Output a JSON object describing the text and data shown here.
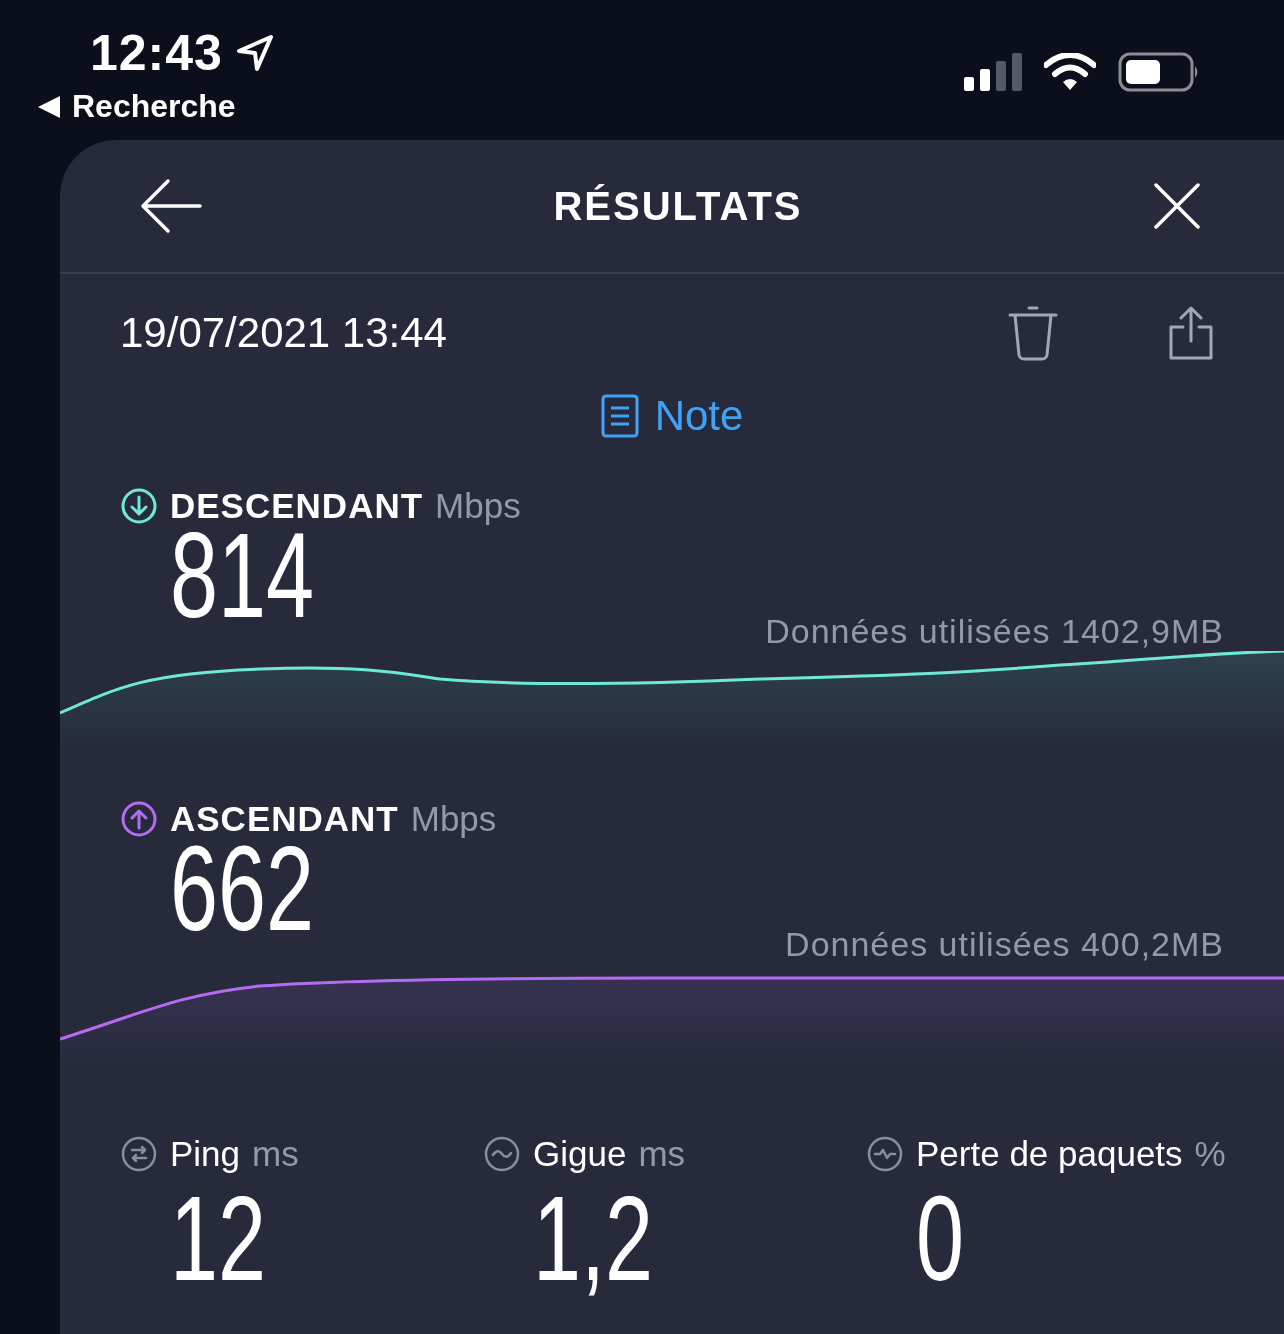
{
  "status_bar": {
    "time": "12:43",
    "back_label": "Recherche"
  },
  "header": {
    "title": "RÉSULTATS"
  },
  "result": {
    "datetime": "19/07/2021 13:44",
    "note_label": "Note"
  },
  "speeds": [
    {
      "kind": "download",
      "label": "DESCENDANT",
      "unit": "Mbps",
      "value": "814",
      "data_used": "Données utilisées 1402,9MB",
      "color": "#6ee8d8"
    },
    {
      "kind": "upload",
      "label": "ASCENDANT",
      "unit": "Mbps",
      "value": "662",
      "data_used": "Données utilisées 400,2MB",
      "color": "#b36cf2"
    }
  ],
  "metrics": [
    {
      "kind": "ping",
      "label": "Ping",
      "unit": "ms",
      "value": "12"
    },
    {
      "kind": "jitter",
      "label": "Gigue",
      "unit": "ms",
      "value": "1,2"
    },
    {
      "kind": "loss",
      "label": "Perte de paquets",
      "unit": "%",
      "value": "0"
    }
  ]
}
